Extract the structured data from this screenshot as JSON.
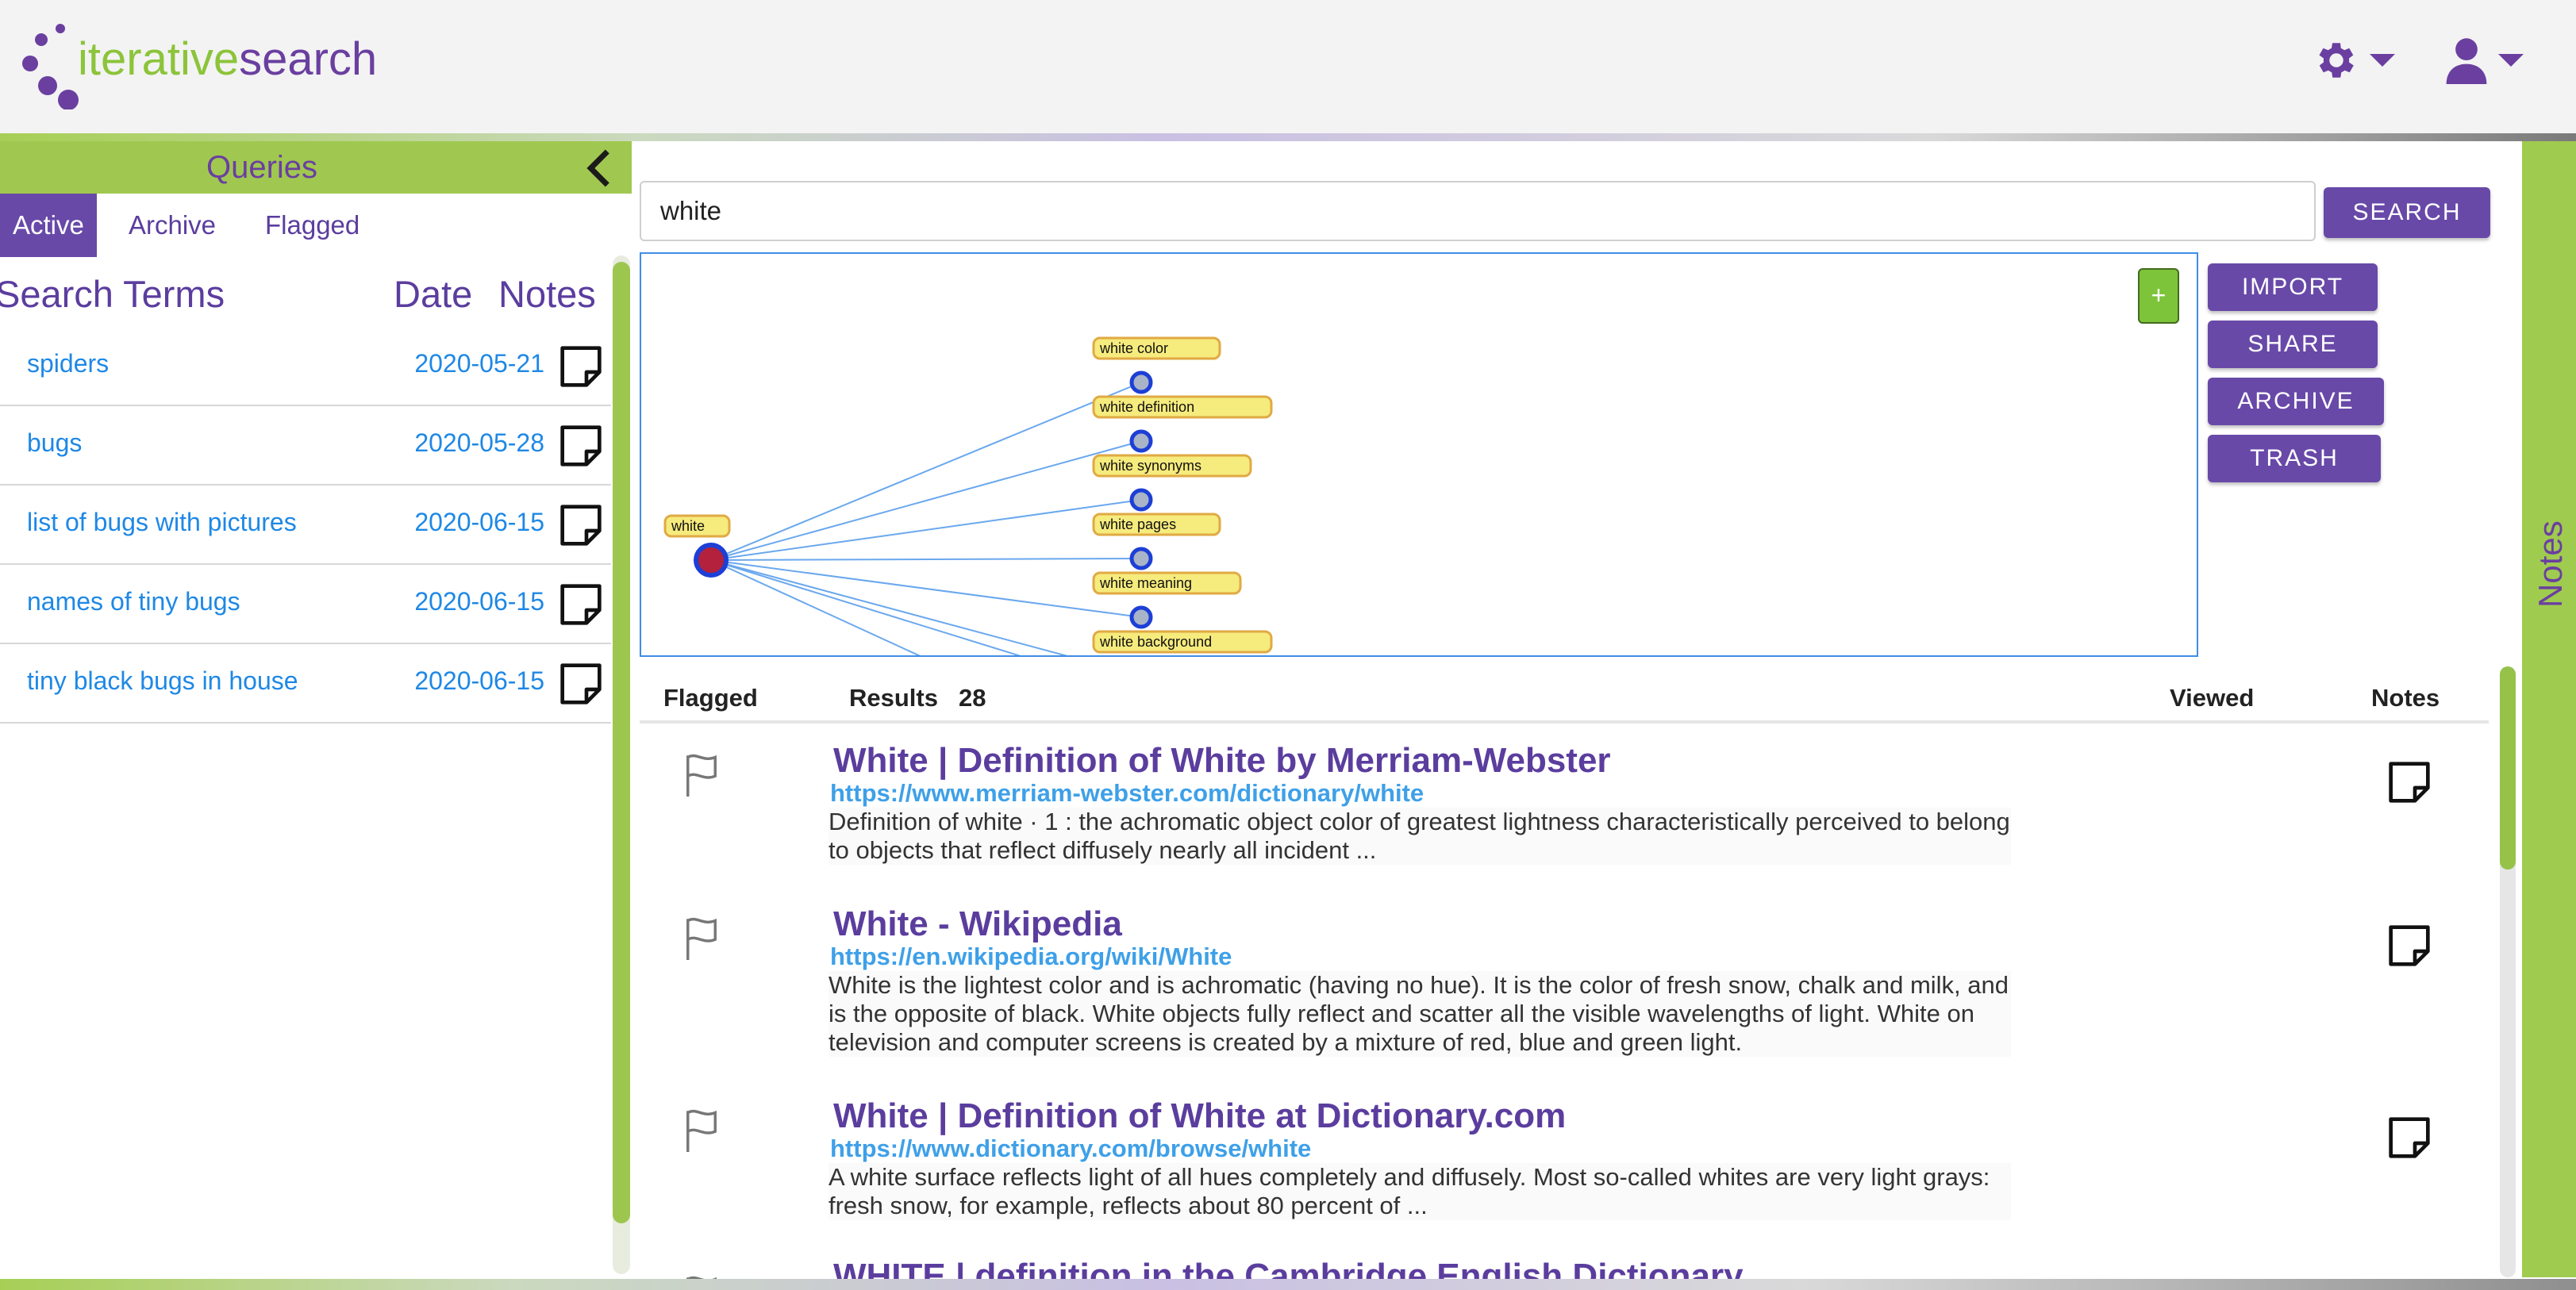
{
  "app": {
    "logo_word1": "iterative",
    "logo_word2": "search"
  },
  "colors": {
    "brand_green": "#8cc43a",
    "brand_purple": "#6a3fa0",
    "link_blue": "#1e88e5"
  },
  "header": {
    "settings_icon": "gear-icon",
    "user_icon": "user-icon"
  },
  "sidebar": {
    "title": "Queries",
    "tabs": [
      {
        "label": "Active",
        "active": true
      },
      {
        "label": "Archive"
      },
      {
        "label": "Flagged"
      }
    ],
    "columns": {
      "terms": "Search Terms",
      "date": "Date",
      "notes": "Notes"
    },
    "queries": [
      {
        "term": "spiders",
        "date": "2020-05-21"
      },
      {
        "term": "bugs",
        "date": "2020-05-28"
      },
      {
        "term": "list of bugs with pictures",
        "date": "2020-06-15"
      },
      {
        "term": "names of tiny bugs",
        "date": "2020-06-15"
      },
      {
        "term": "tiny black bugs in house",
        "date": "2020-06-15"
      }
    ]
  },
  "search": {
    "value": "white",
    "button": "SEARCH"
  },
  "actions": {
    "import": "IMPORT",
    "share": "SHARE",
    "archive": "ARCHIVE",
    "trash": "TRASH"
  },
  "graph": {
    "add_button": "+",
    "root": "white",
    "children": [
      "white color",
      "white definition",
      "white synonyms",
      "white pages",
      "white meaning",
      "white background"
    ]
  },
  "results": {
    "headers": {
      "flagged": "Flagged",
      "results": "Results",
      "count": "28",
      "viewed": "Viewed",
      "notes": "Notes"
    },
    "items": [
      {
        "title": "White | Definition of White by Merriam-Webster",
        "url": "https://www.merriam-webster.com/dictionary/white",
        "snippet": "Definition of white · 1 : the achromatic object color of greatest lightness characteristically perceived to belong to objects that reflect diffusely nearly all incident ..."
      },
      {
        "title": "White - Wikipedia",
        "url": "https://en.wikipedia.org/wiki/White",
        "snippet": "White is the lightest color and is achromatic (having no hue). It is the color of fresh snow, chalk and milk, and is the opposite of black. White objects fully reflect and scatter all the visible wavelengths of light. White on television and computer screens is created by a mixture of red, blue and green light."
      },
      {
        "title": "White | Definition of White at Dictionary.com",
        "url": "https://www.dictionary.com/browse/white",
        "snippet": "A white surface reflects light of all hues completely and diffusely. Most so-called whites are very light grays: fresh snow, for example, reflects about 80 percent of ..."
      },
      {
        "title": "WHITE | definition in the Cambridge English Dictionary",
        "url": "",
        "snippet": ""
      }
    ]
  },
  "notes_panel": {
    "label": "Notes"
  }
}
